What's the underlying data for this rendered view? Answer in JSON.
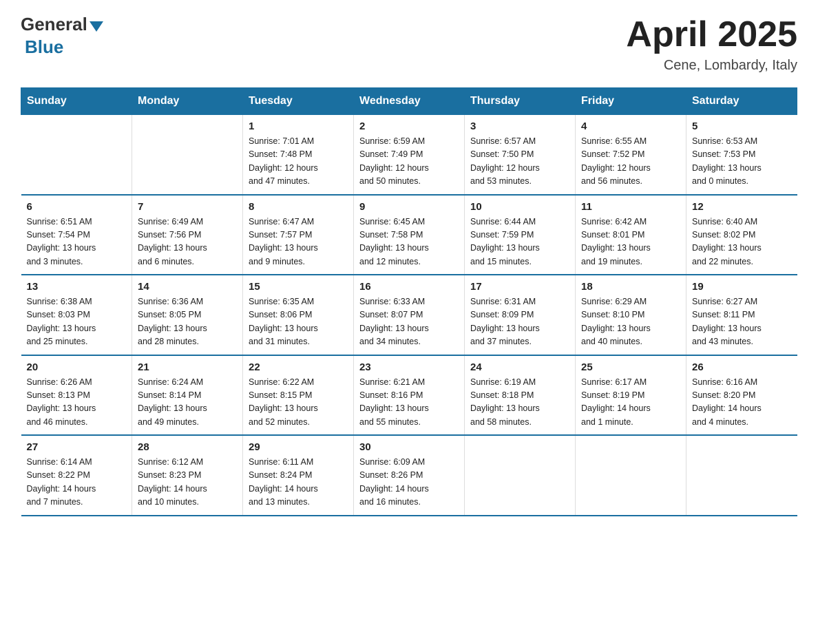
{
  "logo": {
    "general": "General",
    "blue": "Blue"
  },
  "title": "April 2025",
  "location": "Cene, Lombardy, Italy",
  "days_of_week": [
    "Sunday",
    "Monday",
    "Tuesday",
    "Wednesday",
    "Thursday",
    "Friday",
    "Saturday"
  ],
  "weeks": [
    [
      {
        "num": "",
        "info": ""
      },
      {
        "num": "",
        "info": ""
      },
      {
        "num": "1",
        "info": "Sunrise: 7:01 AM\nSunset: 7:48 PM\nDaylight: 12 hours\nand 47 minutes."
      },
      {
        "num": "2",
        "info": "Sunrise: 6:59 AM\nSunset: 7:49 PM\nDaylight: 12 hours\nand 50 minutes."
      },
      {
        "num": "3",
        "info": "Sunrise: 6:57 AM\nSunset: 7:50 PM\nDaylight: 12 hours\nand 53 minutes."
      },
      {
        "num": "4",
        "info": "Sunrise: 6:55 AM\nSunset: 7:52 PM\nDaylight: 12 hours\nand 56 minutes."
      },
      {
        "num": "5",
        "info": "Sunrise: 6:53 AM\nSunset: 7:53 PM\nDaylight: 13 hours\nand 0 minutes."
      }
    ],
    [
      {
        "num": "6",
        "info": "Sunrise: 6:51 AM\nSunset: 7:54 PM\nDaylight: 13 hours\nand 3 minutes."
      },
      {
        "num": "7",
        "info": "Sunrise: 6:49 AM\nSunset: 7:56 PM\nDaylight: 13 hours\nand 6 minutes."
      },
      {
        "num": "8",
        "info": "Sunrise: 6:47 AM\nSunset: 7:57 PM\nDaylight: 13 hours\nand 9 minutes."
      },
      {
        "num": "9",
        "info": "Sunrise: 6:45 AM\nSunset: 7:58 PM\nDaylight: 13 hours\nand 12 minutes."
      },
      {
        "num": "10",
        "info": "Sunrise: 6:44 AM\nSunset: 7:59 PM\nDaylight: 13 hours\nand 15 minutes."
      },
      {
        "num": "11",
        "info": "Sunrise: 6:42 AM\nSunset: 8:01 PM\nDaylight: 13 hours\nand 19 minutes."
      },
      {
        "num": "12",
        "info": "Sunrise: 6:40 AM\nSunset: 8:02 PM\nDaylight: 13 hours\nand 22 minutes."
      }
    ],
    [
      {
        "num": "13",
        "info": "Sunrise: 6:38 AM\nSunset: 8:03 PM\nDaylight: 13 hours\nand 25 minutes."
      },
      {
        "num": "14",
        "info": "Sunrise: 6:36 AM\nSunset: 8:05 PM\nDaylight: 13 hours\nand 28 minutes."
      },
      {
        "num": "15",
        "info": "Sunrise: 6:35 AM\nSunset: 8:06 PM\nDaylight: 13 hours\nand 31 minutes."
      },
      {
        "num": "16",
        "info": "Sunrise: 6:33 AM\nSunset: 8:07 PM\nDaylight: 13 hours\nand 34 minutes."
      },
      {
        "num": "17",
        "info": "Sunrise: 6:31 AM\nSunset: 8:09 PM\nDaylight: 13 hours\nand 37 minutes."
      },
      {
        "num": "18",
        "info": "Sunrise: 6:29 AM\nSunset: 8:10 PM\nDaylight: 13 hours\nand 40 minutes."
      },
      {
        "num": "19",
        "info": "Sunrise: 6:27 AM\nSunset: 8:11 PM\nDaylight: 13 hours\nand 43 minutes."
      }
    ],
    [
      {
        "num": "20",
        "info": "Sunrise: 6:26 AM\nSunset: 8:13 PM\nDaylight: 13 hours\nand 46 minutes."
      },
      {
        "num": "21",
        "info": "Sunrise: 6:24 AM\nSunset: 8:14 PM\nDaylight: 13 hours\nand 49 minutes."
      },
      {
        "num": "22",
        "info": "Sunrise: 6:22 AM\nSunset: 8:15 PM\nDaylight: 13 hours\nand 52 minutes."
      },
      {
        "num": "23",
        "info": "Sunrise: 6:21 AM\nSunset: 8:16 PM\nDaylight: 13 hours\nand 55 minutes."
      },
      {
        "num": "24",
        "info": "Sunrise: 6:19 AM\nSunset: 8:18 PM\nDaylight: 13 hours\nand 58 minutes."
      },
      {
        "num": "25",
        "info": "Sunrise: 6:17 AM\nSunset: 8:19 PM\nDaylight: 14 hours\nand 1 minute."
      },
      {
        "num": "26",
        "info": "Sunrise: 6:16 AM\nSunset: 8:20 PM\nDaylight: 14 hours\nand 4 minutes."
      }
    ],
    [
      {
        "num": "27",
        "info": "Sunrise: 6:14 AM\nSunset: 8:22 PM\nDaylight: 14 hours\nand 7 minutes."
      },
      {
        "num": "28",
        "info": "Sunrise: 6:12 AM\nSunset: 8:23 PM\nDaylight: 14 hours\nand 10 minutes."
      },
      {
        "num": "29",
        "info": "Sunrise: 6:11 AM\nSunset: 8:24 PM\nDaylight: 14 hours\nand 13 minutes."
      },
      {
        "num": "30",
        "info": "Sunrise: 6:09 AM\nSunset: 8:26 PM\nDaylight: 14 hours\nand 16 minutes."
      },
      {
        "num": "",
        "info": ""
      },
      {
        "num": "",
        "info": ""
      },
      {
        "num": "",
        "info": ""
      }
    ]
  ]
}
